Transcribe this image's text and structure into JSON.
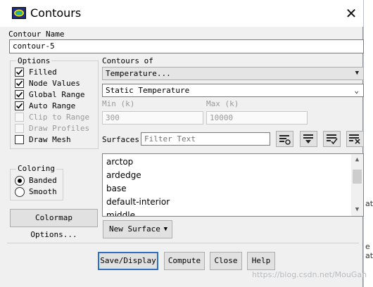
{
  "window": {
    "title": "Contours"
  },
  "background_app": {
    "lines": [
      "at",
      "e",
      "at"
    ]
  },
  "contour_name": {
    "label": "Contour Name",
    "value": "contour-5"
  },
  "options": {
    "label": "Options",
    "items": [
      {
        "label": "Filled",
        "checked": true,
        "enabled": true
      },
      {
        "label": "Node Values",
        "checked": true,
        "enabled": true
      },
      {
        "label": "Global Range",
        "checked": true,
        "enabled": true
      },
      {
        "label": "Auto Range",
        "checked": true,
        "enabled": true
      },
      {
        "label": "Clip to Range",
        "checked": false,
        "enabled": false
      },
      {
        "label": "Draw Profiles",
        "checked": false,
        "enabled": false
      },
      {
        "label": "Draw Mesh",
        "checked": false,
        "enabled": true
      }
    ]
  },
  "coloring": {
    "label": "Coloring",
    "options": [
      {
        "label": "Banded",
        "selected": true
      },
      {
        "label": "Smooth",
        "selected": false
      }
    ]
  },
  "colormap_button": "Colormap Options...",
  "contours_of": {
    "label": "Contours of",
    "category": "Temperature...",
    "variable": "Static Temperature"
  },
  "range": {
    "min_label": "Min (k)",
    "min_value": "300",
    "max_label": "Max (k)",
    "max_value": "10000"
  },
  "surfaces": {
    "label": "Surfaces",
    "filter_placeholder": "Filter Text",
    "tool_icons": [
      "select-surface-tool-icon",
      "group-dropdown-icon",
      "select-all-icon",
      "deselect-all-icon"
    ],
    "items": [
      "arctop",
      "ardedge",
      "base",
      "default-interior",
      "middle"
    ]
  },
  "new_surface_button": "New Surface",
  "actions": {
    "save": "Save/Display",
    "compute": "Compute",
    "close": "Close",
    "help": "Help"
  },
  "watermark": "https://blog.csdn.net/MouGan",
  "colors": {
    "accent": "#2f6fc2",
    "dialog_bg": "#f0f0f0"
  }
}
